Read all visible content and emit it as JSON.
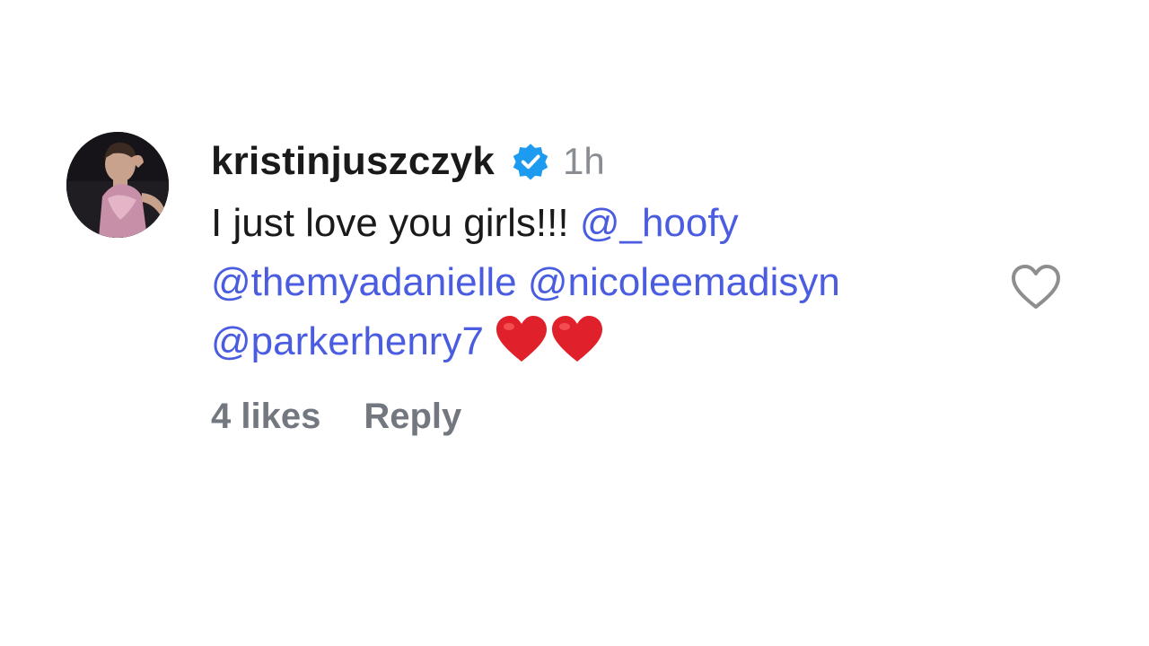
{
  "comment": {
    "avatar_icon": "profile-photo",
    "username": "kristinjuszczyk",
    "verified_icon": "verified-badge-icon",
    "verified_color": "#1d9bf0",
    "timestamp": "1h",
    "text_lines": [
      {
        "plain": "I just love you girls!!! ",
        "mention": "@_hoofy"
      },
      {
        "mention1": "@themyadanielle",
        "mention2": "@nicoleemadisyn"
      },
      {
        "mention": "@parkerhenry7"
      }
    ],
    "emoji": "red-heart-emoji",
    "emoji_count": 2,
    "mention_color": "#4a5ce0",
    "likes": "4 likes",
    "reply_label": "Reply",
    "like_icon": "heart-outline-icon"
  }
}
